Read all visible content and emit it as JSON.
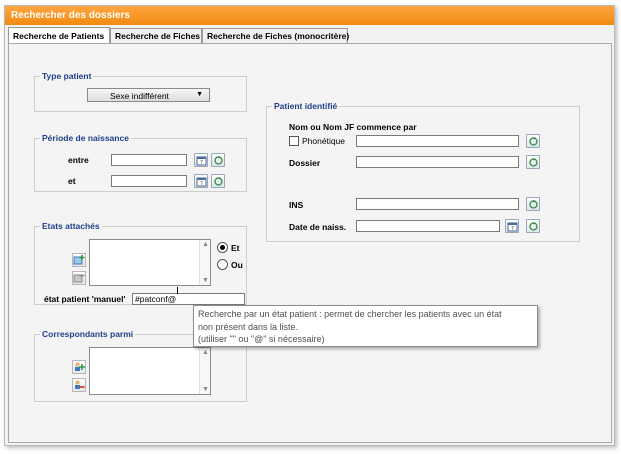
{
  "window": {
    "title": "Rechercher des dossiers",
    "accent": "#f28a12"
  },
  "tabs": [
    {
      "label": "Recherche de Patients",
      "active": true
    },
    {
      "label": "Recherche de Fiches",
      "active": false
    },
    {
      "label": "Recherche de Fiches (monocritère)",
      "active": false
    }
  ],
  "type_patient": {
    "title": "Type patient",
    "select_value": "Sexe indifférent"
  },
  "periode": {
    "title": "Période de naissance",
    "entre_label": "entre",
    "et_label": "et",
    "entre_value": "",
    "et_value": ""
  },
  "etats": {
    "title": "Etats attachés",
    "radio_et": "Et",
    "radio_ou": "Ou",
    "manual_label": "état patient 'manuel'",
    "manual_value": "#patconf@"
  },
  "correspondants": {
    "title": "Correspondants parmi"
  },
  "patient_identifie": {
    "title": "Patient identifié",
    "nom_label": "Nom ou Nom JF commence par",
    "phonetique_label": "Phonétique",
    "dossier_label": "Dossier",
    "ins_label": "INS",
    "date_label": "Date de naiss.",
    "nom_value": "",
    "dossier_value": "",
    "ins_value": "",
    "date_value": ""
  },
  "tooltip": {
    "line1": "Recherche par un état patient : permet de chercher les patients avec un état",
    "line2": "non présent dans la liste.",
    "line3": "(utiliser \"\" ou \"@\" si nécessaire)"
  },
  "icons": {
    "calendar": "calendar-icon",
    "refresh": "refresh-icon",
    "add": "add-icon",
    "remove": "remove-icon"
  }
}
